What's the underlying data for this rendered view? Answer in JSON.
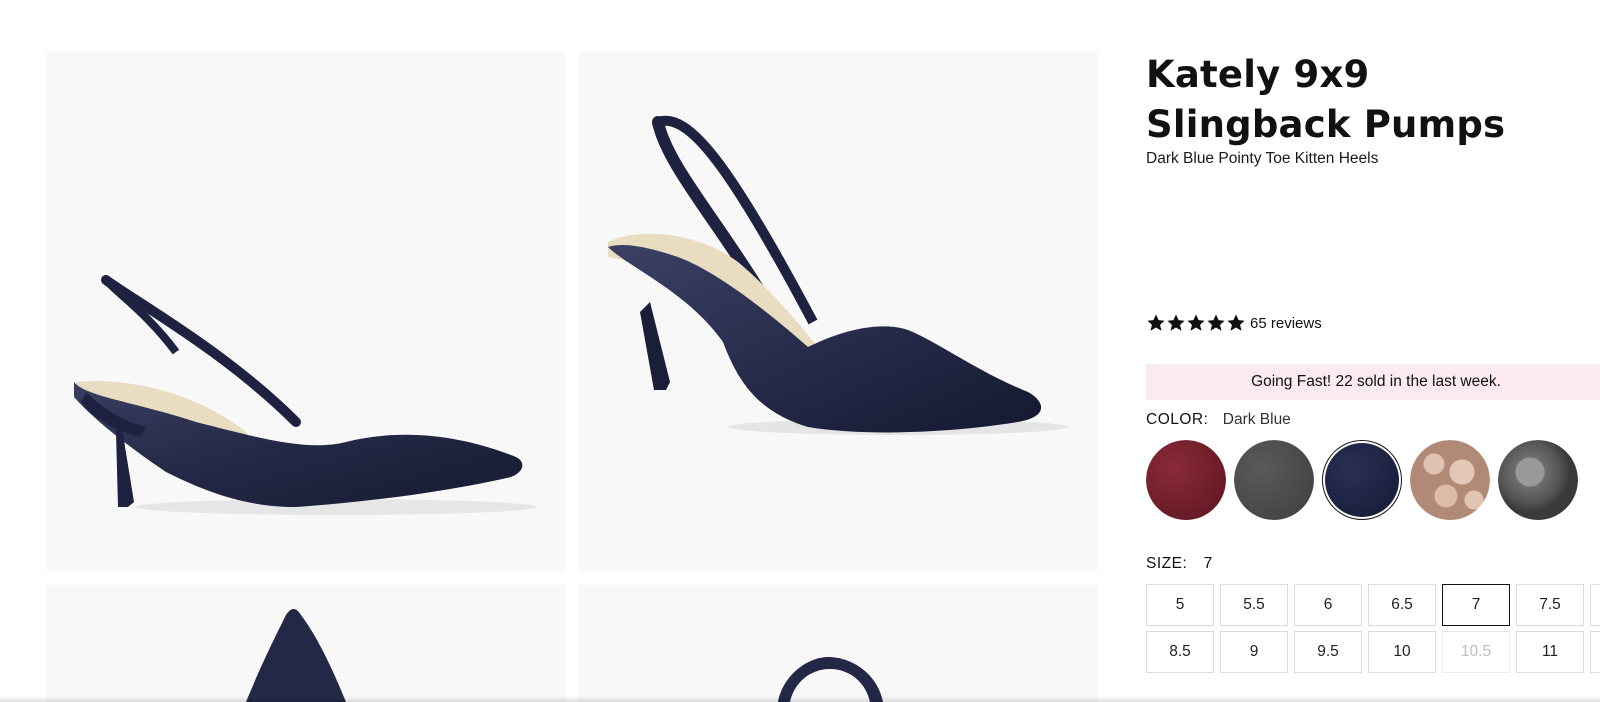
{
  "product": {
    "title": "Kately 9x9 Slingback Pumps",
    "subtitle": "Dark Blue Pointy Toe Kitten Heels",
    "rating": 5,
    "reviews_label": "65 reviews"
  },
  "urgency_banner": "Going Fast! 22 sold in the last week.",
  "color": {
    "label": "COLOR:",
    "selected": "Dark Blue",
    "swatches": [
      {
        "name": "burgundy",
        "color": "#6b1a26"
      },
      {
        "name": "charcoal",
        "color": "#4a4a4a"
      },
      {
        "name": "dark-blue",
        "color": "#1a1f3f"
      },
      {
        "name": "snake-beige",
        "color": "#cfa996"
      },
      {
        "name": "grey-patent",
        "color": "#7b7b7b"
      }
    ]
  },
  "size": {
    "label": "SIZE:",
    "selected": "7",
    "row1": [
      "5",
      "5.5",
      "6",
      "6.5",
      "7",
      "7.5"
    ],
    "row2": [
      "8.5",
      "9",
      "9.5",
      "10",
      "10.5",
      "11"
    ],
    "unavailable": [
      "10.5"
    ]
  },
  "colors": {
    "banner_bg": "#fbeaf1",
    "tile_bg": "#f8f8f8",
    "shoe_navy": "#232846",
    "insole_beige": "#e8dcc1"
  }
}
